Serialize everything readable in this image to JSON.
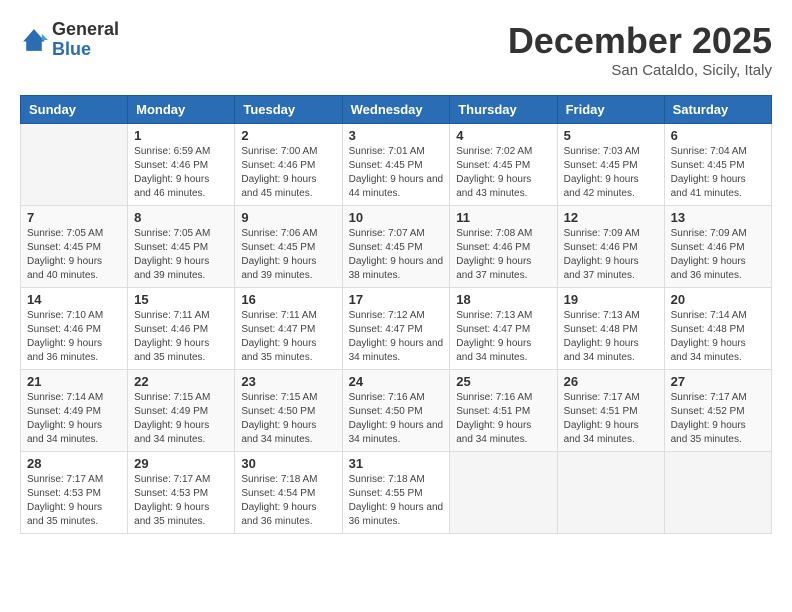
{
  "header": {
    "logo_general": "General",
    "logo_blue": "Blue",
    "title": "December 2025",
    "location": "San Cataldo, Sicily, Italy"
  },
  "days_of_week": [
    "Sunday",
    "Monday",
    "Tuesday",
    "Wednesday",
    "Thursday",
    "Friday",
    "Saturday"
  ],
  "weeks": [
    [
      {
        "day": "",
        "sunrise": "",
        "sunset": "",
        "daylight": ""
      },
      {
        "day": "1",
        "sunrise": "6:59 AM",
        "sunset": "4:46 PM",
        "daylight": "9 hours and 46 minutes."
      },
      {
        "day": "2",
        "sunrise": "7:00 AM",
        "sunset": "4:46 PM",
        "daylight": "9 hours and 45 minutes."
      },
      {
        "day": "3",
        "sunrise": "7:01 AM",
        "sunset": "4:45 PM",
        "daylight": "9 hours and 44 minutes."
      },
      {
        "day": "4",
        "sunrise": "7:02 AM",
        "sunset": "4:45 PM",
        "daylight": "9 hours and 43 minutes."
      },
      {
        "day": "5",
        "sunrise": "7:03 AM",
        "sunset": "4:45 PM",
        "daylight": "9 hours and 42 minutes."
      },
      {
        "day": "6",
        "sunrise": "7:04 AM",
        "sunset": "4:45 PM",
        "daylight": "9 hours and 41 minutes."
      }
    ],
    [
      {
        "day": "7",
        "sunrise": "7:05 AM",
        "sunset": "4:45 PM",
        "daylight": "9 hours and 40 minutes."
      },
      {
        "day": "8",
        "sunrise": "7:05 AM",
        "sunset": "4:45 PM",
        "daylight": "9 hours and 39 minutes."
      },
      {
        "day": "9",
        "sunrise": "7:06 AM",
        "sunset": "4:45 PM",
        "daylight": "9 hours and 39 minutes."
      },
      {
        "day": "10",
        "sunrise": "7:07 AM",
        "sunset": "4:45 PM",
        "daylight": "9 hours and 38 minutes."
      },
      {
        "day": "11",
        "sunrise": "7:08 AM",
        "sunset": "4:46 PM",
        "daylight": "9 hours and 37 minutes."
      },
      {
        "day": "12",
        "sunrise": "7:09 AM",
        "sunset": "4:46 PM",
        "daylight": "9 hours and 37 minutes."
      },
      {
        "day": "13",
        "sunrise": "7:09 AM",
        "sunset": "4:46 PM",
        "daylight": "9 hours and 36 minutes."
      }
    ],
    [
      {
        "day": "14",
        "sunrise": "7:10 AM",
        "sunset": "4:46 PM",
        "daylight": "9 hours and 36 minutes."
      },
      {
        "day": "15",
        "sunrise": "7:11 AM",
        "sunset": "4:46 PM",
        "daylight": "9 hours and 35 minutes."
      },
      {
        "day": "16",
        "sunrise": "7:11 AM",
        "sunset": "4:47 PM",
        "daylight": "9 hours and 35 minutes."
      },
      {
        "day": "17",
        "sunrise": "7:12 AM",
        "sunset": "4:47 PM",
        "daylight": "9 hours and 34 minutes."
      },
      {
        "day": "18",
        "sunrise": "7:13 AM",
        "sunset": "4:47 PM",
        "daylight": "9 hours and 34 minutes."
      },
      {
        "day": "19",
        "sunrise": "7:13 AM",
        "sunset": "4:48 PM",
        "daylight": "9 hours and 34 minutes."
      },
      {
        "day": "20",
        "sunrise": "7:14 AM",
        "sunset": "4:48 PM",
        "daylight": "9 hours and 34 minutes."
      }
    ],
    [
      {
        "day": "21",
        "sunrise": "7:14 AM",
        "sunset": "4:49 PM",
        "daylight": "9 hours and 34 minutes."
      },
      {
        "day": "22",
        "sunrise": "7:15 AM",
        "sunset": "4:49 PM",
        "daylight": "9 hours and 34 minutes."
      },
      {
        "day": "23",
        "sunrise": "7:15 AM",
        "sunset": "4:50 PM",
        "daylight": "9 hours and 34 minutes."
      },
      {
        "day": "24",
        "sunrise": "7:16 AM",
        "sunset": "4:50 PM",
        "daylight": "9 hours and 34 minutes."
      },
      {
        "day": "25",
        "sunrise": "7:16 AM",
        "sunset": "4:51 PM",
        "daylight": "9 hours and 34 minutes."
      },
      {
        "day": "26",
        "sunrise": "7:17 AM",
        "sunset": "4:51 PM",
        "daylight": "9 hours and 34 minutes."
      },
      {
        "day": "27",
        "sunrise": "7:17 AM",
        "sunset": "4:52 PM",
        "daylight": "9 hours and 35 minutes."
      }
    ],
    [
      {
        "day": "28",
        "sunrise": "7:17 AM",
        "sunset": "4:53 PM",
        "daylight": "9 hours and 35 minutes."
      },
      {
        "day": "29",
        "sunrise": "7:17 AM",
        "sunset": "4:53 PM",
        "daylight": "9 hours and 35 minutes."
      },
      {
        "day": "30",
        "sunrise": "7:18 AM",
        "sunset": "4:54 PM",
        "daylight": "9 hours and 36 minutes."
      },
      {
        "day": "31",
        "sunrise": "7:18 AM",
        "sunset": "4:55 PM",
        "daylight": "9 hours and 36 minutes."
      },
      {
        "day": "",
        "sunrise": "",
        "sunset": "",
        "daylight": ""
      },
      {
        "day": "",
        "sunrise": "",
        "sunset": "",
        "daylight": ""
      },
      {
        "day": "",
        "sunrise": "",
        "sunset": "",
        "daylight": ""
      }
    ]
  ]
}
